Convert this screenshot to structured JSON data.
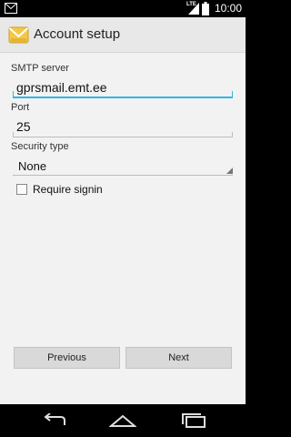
{
  "status_bar": {
    "network_type": "LTE",
    "time": "10:00",
    "icons": [
      "email-notification-icon",
      "signal-icon",
      "battery-icon"
    ]
  },
  "action_bar": {
    "title": "Account setup",
    "icon": "email-app-icon"
  },
  "form": {
    "smtp_server": {
      "label": "SMTP server",
      "value": "gprsmail.emt.ee"
    },
    "port": {
      "label": "Port",
      "value": "25"
    },
    "security_type": {
      "label": "Security type",
      "value": "None"
    },
    "require_signin": {
      "label": "Require signin",
      "checked": false
    }
  },
  "buttons": {
    "previous_label": "Previous",
    "next_label": "Next"
  },
  "nav_bar": {
    "icons": [
      "back-icon",
      "home-icon",
      "recents-icon"
    ]
  },
  "colors": {
    "focus_accent": "#33b5e5",
    "background": "#f2f2f2",
    "action_bar": "#e8e8e8",
    "button": "#d9d9d9"
  }
}
